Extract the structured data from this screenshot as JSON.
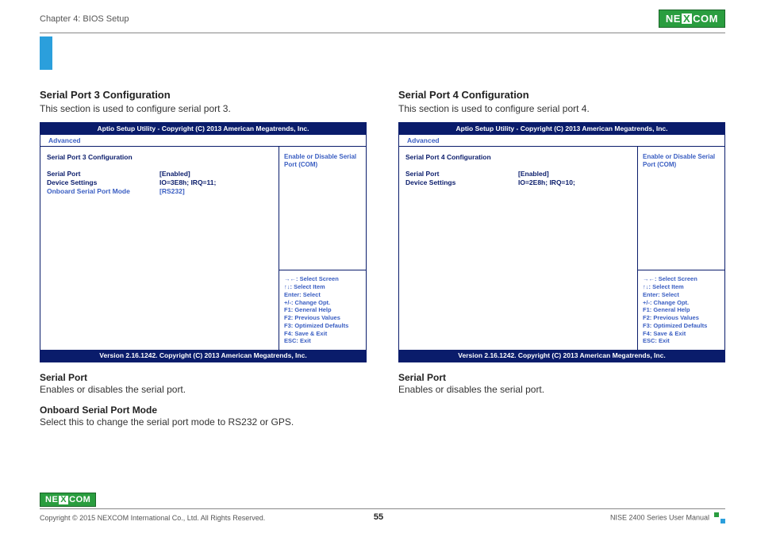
{
  "header": {
    "chapter": "Chapter 4: BIOS Setup",
    "logo_text_1": "NE",
    "logo_text_x": "X",
    "logo_text_2": "COM"
  },
  "left": {
    "title": "Serial Port 3 Configuration",
    "desc": "This section is used to configure serial port 3.",
    "bios": {
      "titlebar": "Aptio Setup Utility - Copyright (C) 2013 American Megatrends, Inc.",
      "tab": "Advanced",
      "heading": "Serial Port 3 Configuration",
      "rows": [
        {
          "label": "Serial Port",
          "value": "[Enabled]",
          "highlight": false
        },
        {
          "label": "Device Settings",
          "value": "IO=3E8h; IRQ=11;",
          "highlight": false
        },
        {
          "label": "Onboard Serial Port Mode",
          "value": "[RS232]",
          "highlight": true
        }
      ],
      "help": "Enable or Disable Serial Port (COM)",
      "keys": [
        "→←: Select Screen",
        "↑↓: Select Item",
        "Enter: Select",
        "+/-: Change Opt.",
        "F1: General Help",
        "F2: Previous Values",
        "F3: Optimized Defaults",
        "F4: Save & Exit",
        "ESC: Exit"
      ],
      "footer": "Version 2.16.1242. Copyright (C) 2013 American Megatrends, Inc."
    },
    "items": [
      {
        "head": "Serial Port",
        "text": "Enables or disables the serial port."
      },
      {
        "head": "Onboard Serial Port Mode",
        "text": "Select this to change the serial port mode to RS232 or GPS."
      }
    ]
  },
  "right": {
    "title": "Serial Port 4 Configuration",
    "desc": "This section is used to configure serial port 4.",
    "bios": {
      "titlebar": "Aptio Setup Utility - Copyright (C) 2013 American Megatrends, Inc.",
      "tab": "Advanced",
      "heading": "Serial Port 4 Configuration",
      "rows": [
        {
          "label": "Serial Port",
          "value": "[Enabled]",
          "highlight": false
        },
        {
          "label": "Device Settings",
          "value": "IO=2E8h; IRQ=10;",
          "highlight": false
        }
      ],
      "help": "Enable or Disable Serial Port (COM)",
      "keys": [
        "→←: Select Screen",
        "↑↓: Select Item",
        "Enter: Select",
        "+/-: Change Opt.",
        "F1: General Help",
        "F2: Previous Values",
        "F3: Optimized Defaults",
        "F4: Save & Exit",
        "ESC: Exit"
      ],
      "footer": "Version 2.16.1242. Copyright (C) 2013 American Megatrends, Inc."
    },
    "items": [
      {
        "head": "Serial Port",
        "text": "Enables or disables the serial port."
      }
    ]
  },
  "footer": {
    "copyright": "Copyright © 2015 NEXCOM International Co., Ltd. All Rights Reserved.",
    "page": "55",
    "manual": "NISE 2400 Series User Manual"
  }
}
